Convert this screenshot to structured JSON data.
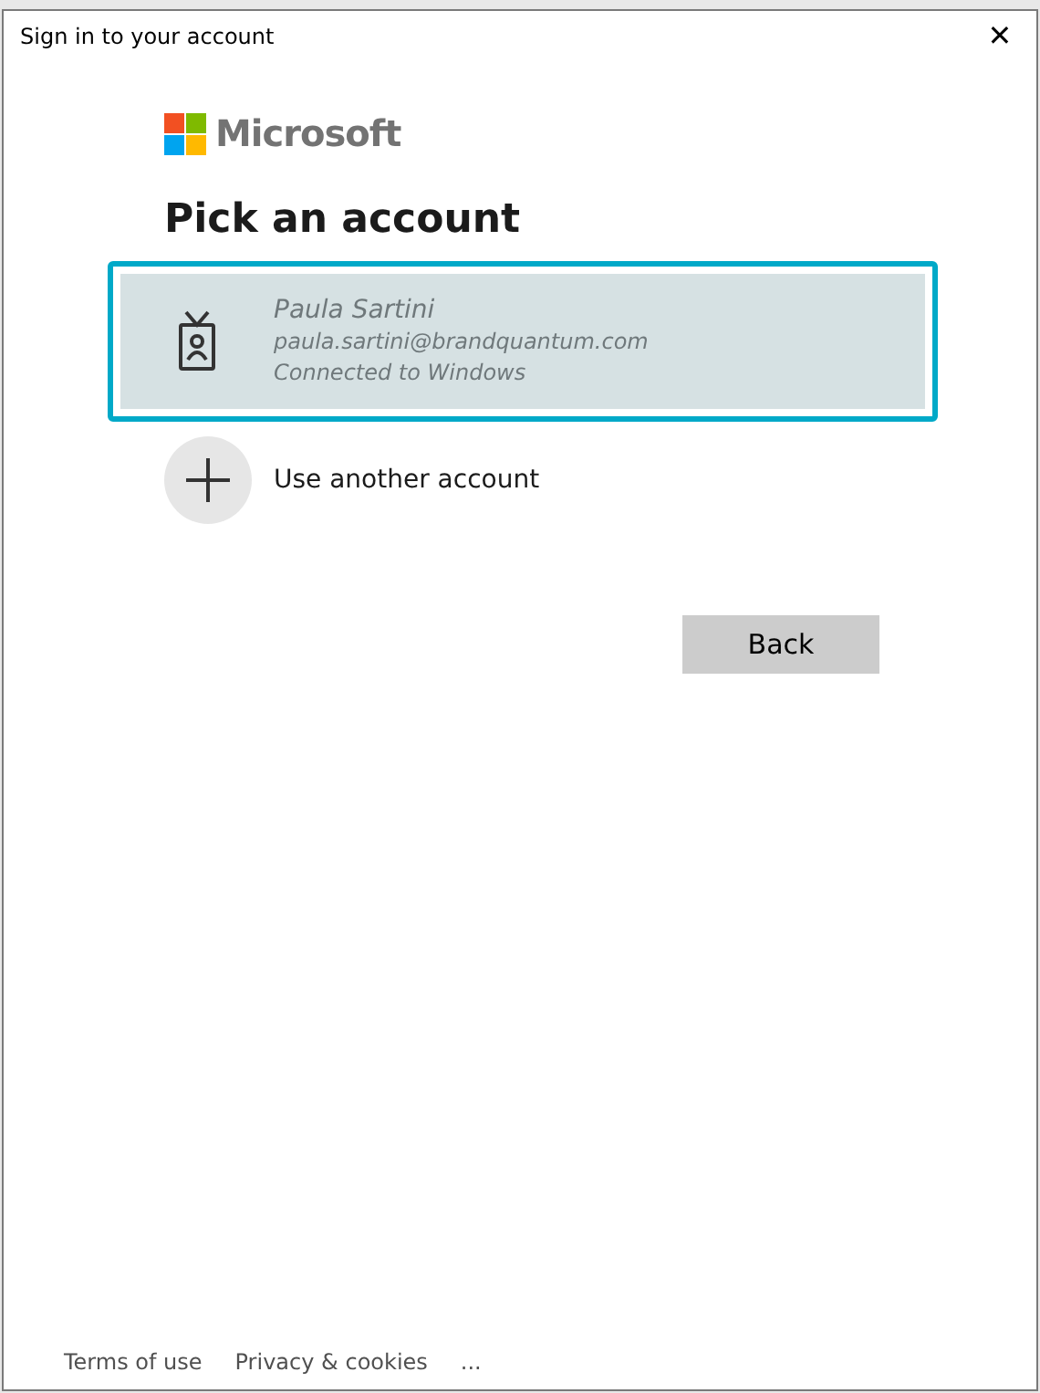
{
  "window": {
    "title": "Sign in to your account",
    "close": "✕"
  },
  "brand": "Microsoft",
  "heading": "Pick an account",
  "accounts": [
    {
      "kind": "account",
      "name": "Paula Sartini",
      "email": "paula.sartini@brandquantum.com",
      "status": "Connected to Windows",
      "selected": true
    },
    {
      "kind": "add",
      "label": "Use another account",
      "selected": false
    }
  ],
  "back_button": "Back",
  "footer": [
    "Terms of use",
    "Privacy & cookies",
    "..."
  ]
}
